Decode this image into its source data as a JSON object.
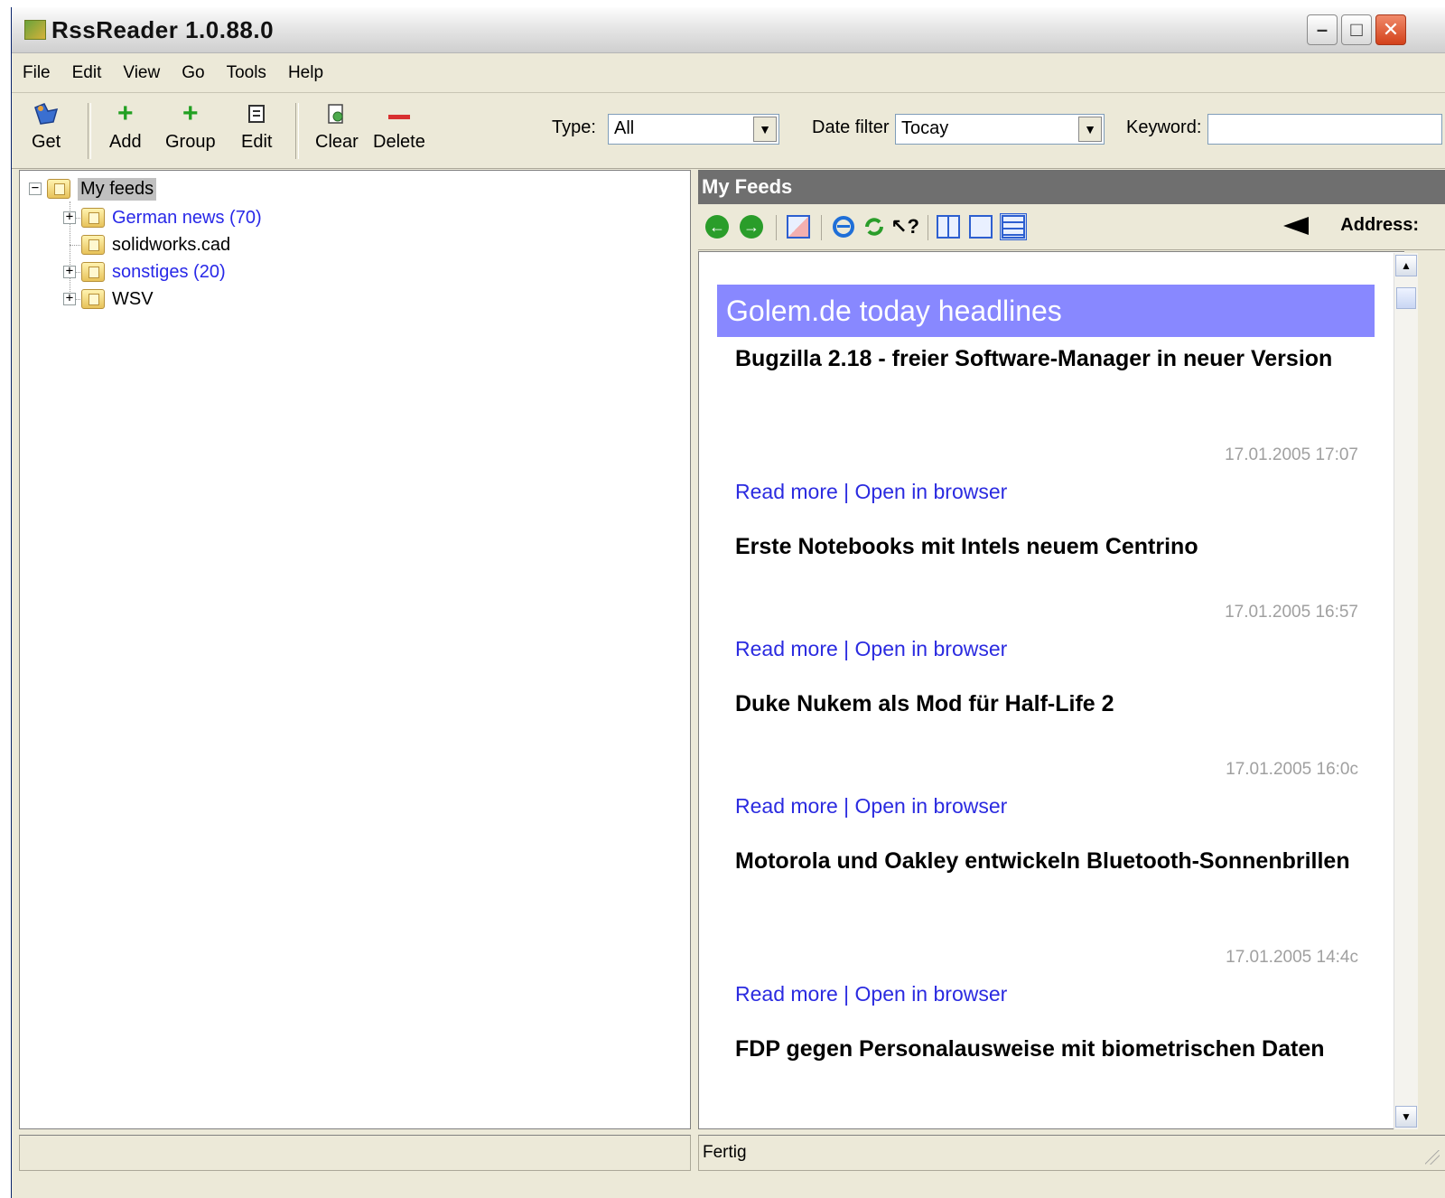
{
  "window": {
    "title": "RssReader  1.0.88.0"
  },
  "menu": [
    "File",
    "Edit",
    "View",
    "Go",
    "Tools",
    "Help"
  ],
  "toolbar": {
    "get": "Get",
    "add": "Add",
    "group": "Group",
    "edit": "Edit",
    "clear": "Clear",
    "delete": "Delete",
    "type_label": "Type:",
    "type_value": "All",
    "date_filter_label": "Date filter",
    "date_filter_value": "Tocay",
    "keyword_label": "Keyword:",
    "keyword_value": ""
  },
  "tree": {
    "root": "My feeds",
    "children": [
      {
        "label": "German news (70)",
        "unread": true,
        "expandable": true
      },
      {
        "label": "solidworks.cad",
        "unread": false,
        "expandable": false
      },
      {
        "label": "sonstiges (20)",
        "unread": true,
        "expandable": true
      },
      {
        "label": "WSV",
        "unread": false,
        "expandable": true
      }
    ]
  },
  "right_pane": {
    "header": "My Feeds",
    "address_label": "Address:",
    "feed_title": "Golem.de today headlines",
    "articles": [
      {
        "title": "Bugzilla 2.18 - freier Software-Manager in neuer Version",
        "date": "17.01.2005 17:07",
        "read_more": "Read more",
        "sep": "|",
        "open_browser": "Open in browser"
      },
      {
        "title": "Erste Notebooks mit Intels neuem Centrino",
        "date": "17.01.2005 16:57",
        "read_more": "Read more",
        "sep": "|",
        "open_browser": "Open in browser"
      },
      {
        "title": "Duke Nukem als Mod für Half-Life 2",
        "date": "17.01.2005 16:0c",
        "read_more": "Read more",
        "sep": "|",
        "open_browser": "Open in browser"
      },
      {
        "title": "Motorola und Oakley entwickeln Bluetooth-Sonnenbrillen",
        "date": "17.01.2005 14:4c",
        "read_more": "Read more",
        "sep": "|",
        "open_browser": "Open in browser"
      },
      {
        "title": "FDP gegen Personalausweise mit biometrischen Daten"
      }
    ]
  },
  "status": {
    "left": "",
    "right": "Fertig"
  },
  "colors": {
    "feed_title_bg": "#8888ff",
    "link": "#2b2be0",
    "header_bg": "#6f6f6f",
    "unread": "#2828e8"
  }
}
